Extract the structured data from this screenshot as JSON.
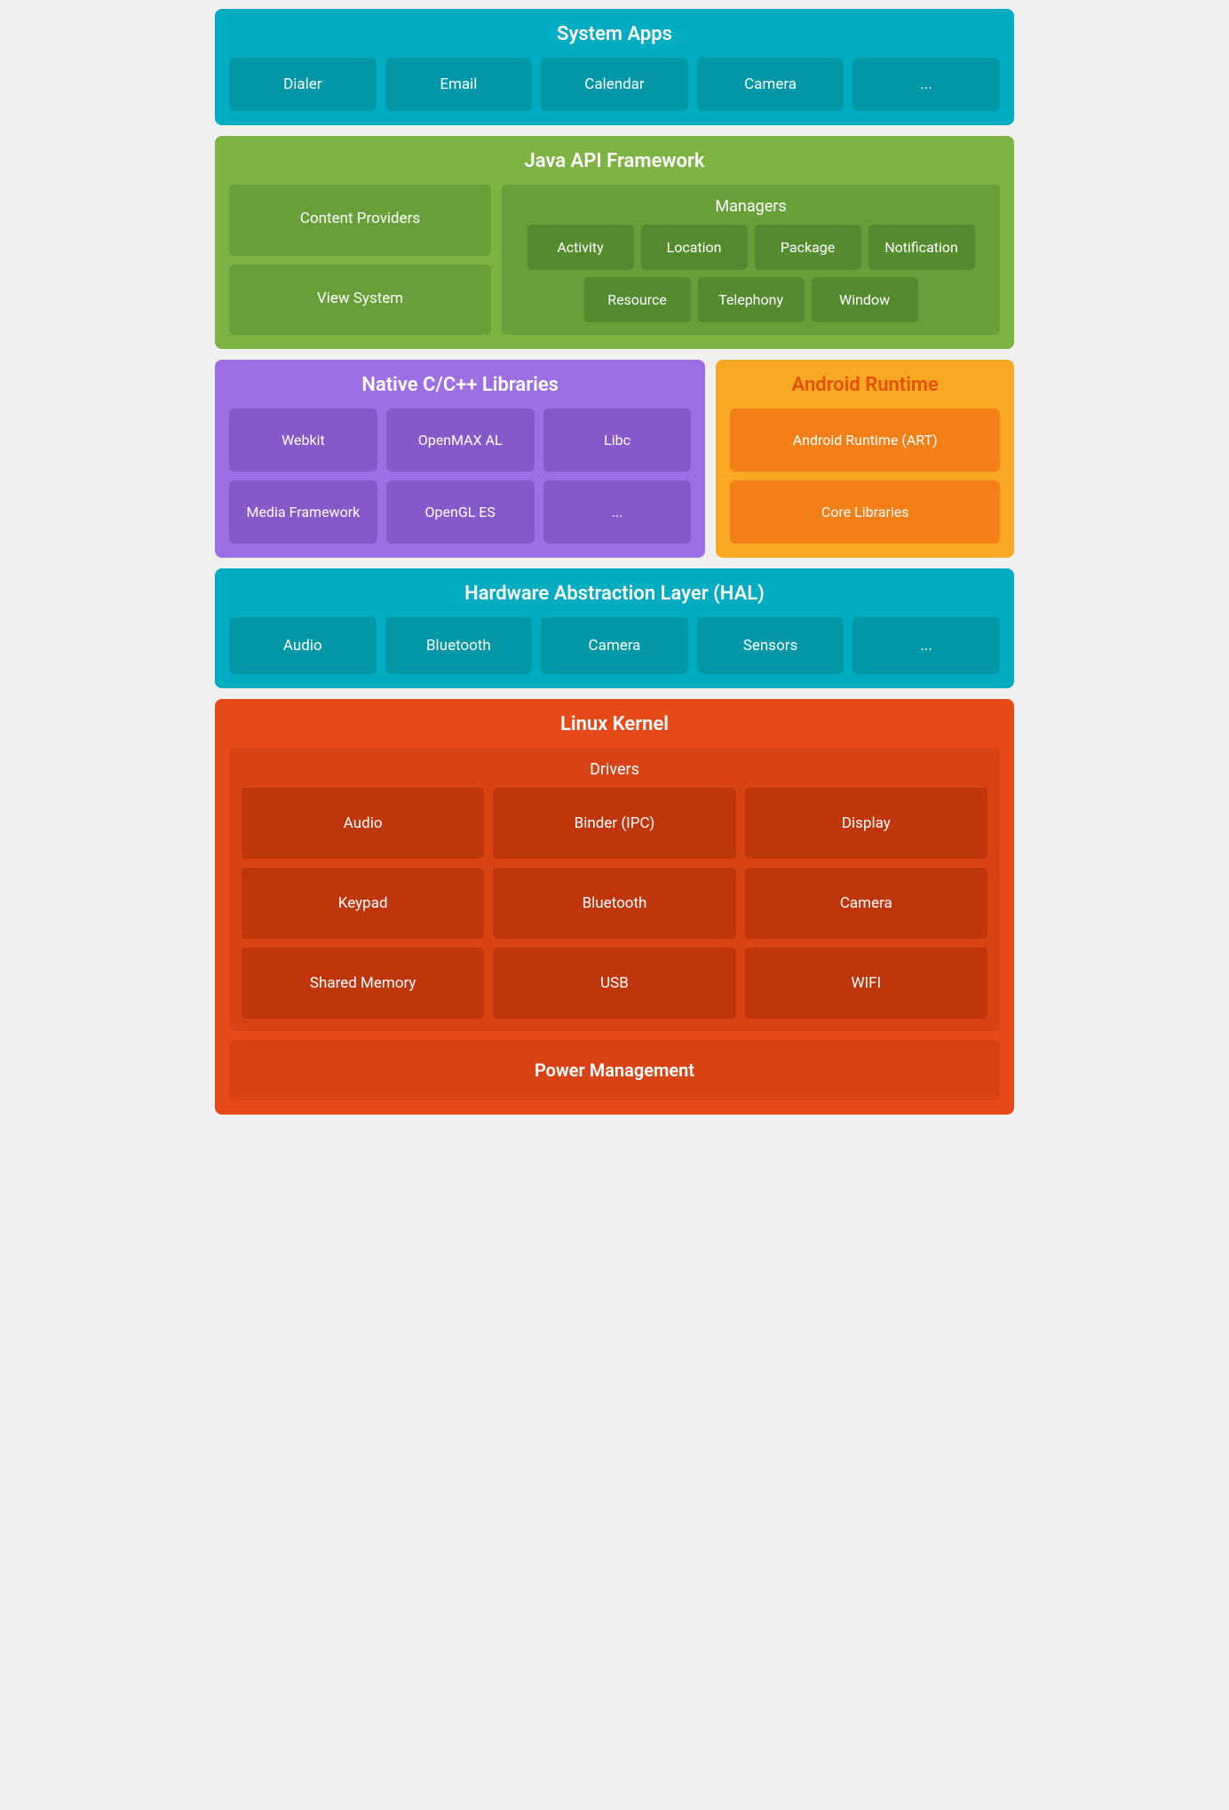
{
  "system_apps": {
    "title": "System Apps",
    "items": [
      "Dialer",
      "Email",
      "Calendar",
      "Camera",
      "..."
    ]
  },
  "java_api": {
    "title": "Java API Framework",
    "content_providers": "Content Providers",
    "view_system": "View System",
    "managers_title": "Managers",
    "managers_row1": [
      "Activity",
      "Location",
      "Package",
      "Notification"
    ],
    "managers_row2": [
      "Resource",
      "Telephony",
      "Window"
    ]
  },
  "native_cpp": {
    "title": "Native C/C++ Libraries",
    "items": [
      "Webkit",
      "OpenMAX AL",
      "Libc",
      "Media Framework",
      "OpenGL ES",
      "..."
    ]
  },
  "android_runtime": {
    "title": "Android Runtime",
    "items": [
      "Android Runtime (ART)",
      "Core Libraries"
    ]
  },
  "hal": {
    "title": "Hardware Abstraction Layer (HAL)",
    "items": [
      "Audio",
      "Bluetooth",
      "Camera",
      "Sensors",
      "..."
    ]
  },
  "linux_kernel": {
    "title": "Linux Kernel",
    "drivers_title": "Drivers",
    "drivers": [
      "Audio",
      "Binder (IPC)",
      "Display",
      "Keypad",
      "Bluetooth",
      "Camera",
      "Shared Memory",
      "USB",
      "WIFI"
    ],
    "power_management": "Power Management"
  }
}
